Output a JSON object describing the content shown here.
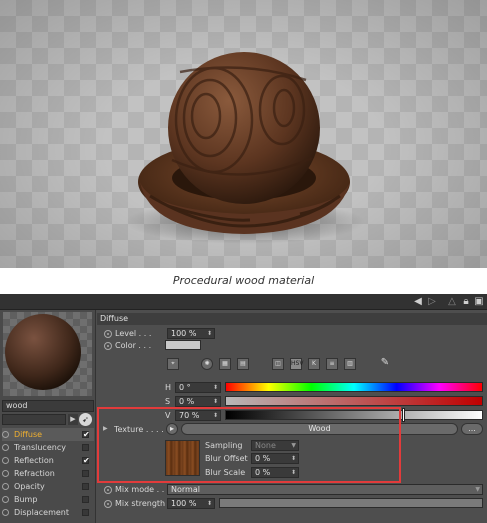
{
  "caption": "Procedural wood material",
  "left_panel": {
    "material_name": "wood",
    "channels": [
      {
        "label": "Diffuse",
        "checked": true,
        "active": true
      },
      {
        "label": "Translucency",
        "checked": false
      },
      {
        "label": "Reflection",
        "checked": true
      },
      {
        "label": "Refraction",
        "checked": false
      },
      {
        "label": "Opacity",
        "checked": false
      },
      {
        "label": "Bump",
        "checked": false
      },
      {
        "label": "Displacement",
        "checked": false
      }
    ]
  },
  "panel": {
    "section_title": "Diffuse",
    "level_label": "Level . . .",
    "level_value": "100 %",
    "color_label": "Color . . .",
    "h_label": "H",
    "h_value": "0 °",
    "s_label": "S",
    "s_value": "0 %",
    "v_label": "V",
    "v_value": "70 %",
    "texture_label": "Texture . . . .",
    "texture_button": "Wood",
    "texture_more": "...",
    "sampling_label": "Sampling",
    "sampling_value": "None",
    "blur_offset_label": "Blur Offset",
    "blur_offset_value": "0 %",
    "blur_scale_label": "Blur Scale",
    "blur_scale_value": "0 %",
    "mix_mode_label": "Mix mode . . .",
    "mix_mode_value": "Normal",
    "mix_strength_label": "Mix strength",
    "mix_strength_value": "100 %"
  },
  "mode_icons": [
    "picker-icon",
    "spectrum-icon",
    "image-icon",
    "rgb-icon",
    "hsv-icon",
    "kelvin-icon",
    "mixer-icon",
    "swatch-icon",
    "eyedropper-icon"
  ],
  "mode_labels": {
    "hsv": "HSV"
  },
  "colors": {
    "accent_active": "#f0b030",
    "highlight_box": "#e23b3b",
    "panel_bg": "#4e4e4e"
  }
}
